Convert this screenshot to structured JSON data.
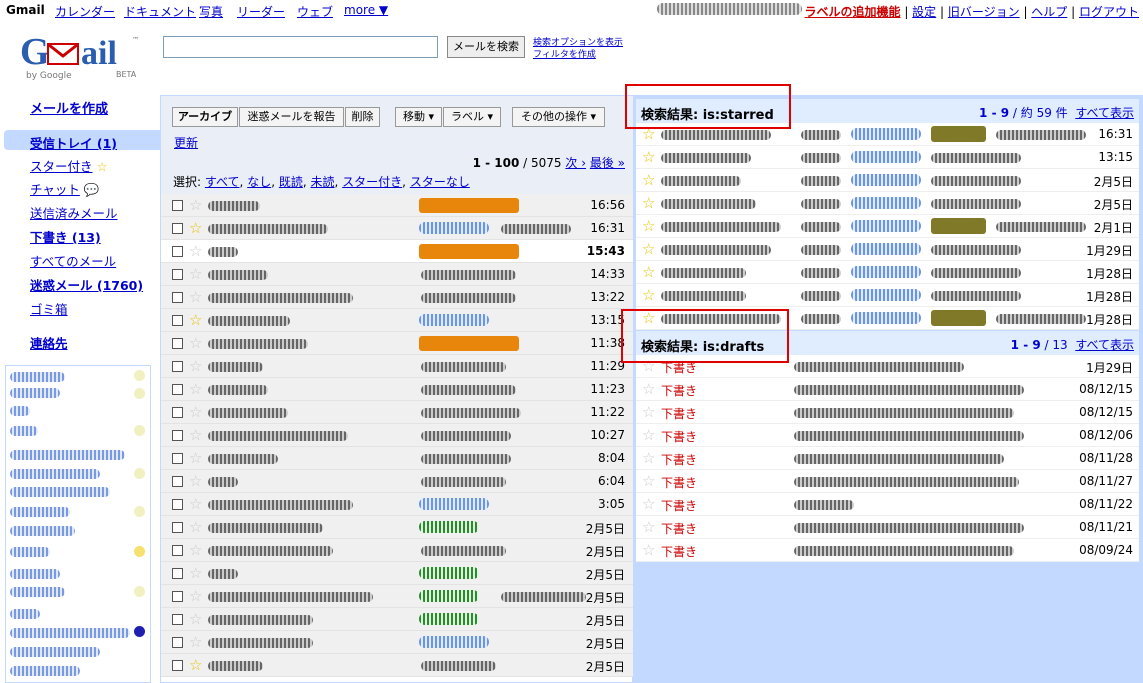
{
  "topnav": {
    "brand": "Gmail",
    "links": [
      "カレンダー",
      "ドキュメント",
      "写真",
      "リーダー",
      "ウェブ",
      "more ▼"
    ],
    "right_links": [
      "ラベルの追加機能",
      "設定",
      "旧バージョン",
      "ヘルプ",
      "ログアウト"
    ]
  },
  "logo": {
    "text_g": "G",
    "text_m": "M",
    "text_ail": "ail",
    "by": "by Google",
    "beta": "BETA",
    "tm": "™"
  },
  "search": {
    "button": "メールを検索",
    "options": "検索オプションを表示",
    "filter": "フィルタを作成"
  },
  "sidebar": {
    "compose": "メールを作成",
    "items": [
      {
        "label": "受信トレイ (1)",
        "bold": true
      },
      {
        "label": "スター付き",
        "icon": "star-icon"
      },
      {
        "label": "チャット",
        "icon": "chat-bubble-icon"
      },
      {
        "label": "送信済みメール"
      },
      {
        "label": "下書き (13)",
        "bold": true
      },
      {
        "label": "すべてのメール"
      },
      {
        "label": "迷惑メール (1760)",
        "bold": true
      },
      {
        "label": "ゴミ箱"
      }
    ],
    "contacts": "連絡先"
  },
  "toolbar": {
    "archive": "アーカイブ",
    "spam": "迷惑メールを報告",
    "delete": "削除",
    "move": "移動 ▾",
    "label": "ラベル ▾",
    "more": "その他の操作 ▾",
    "refresh": "更新",
    "pager_range": "1 - 100",
    "pager_total": " / 5075 ",
    "next": "次 ›",
    "last": "最後 »",
    "select_prefix": "選択: ",
    "select_options": [
      "すべて",
      "なし",
      "既読",
      "未読",
      "スター付き",
      "スターなし"
    ]
  },
  "inbox": {
    "rows": [
      {
        "time": "16:56",
        "starred": false,
        "unread": false,
        "tag": "orange"
      },
      {
        "time": "16:31",
        "starred": true,
        "unread": false,
        "tag": "blue"
      },
      {
        "time": "15:43",
        "starred": false,
        "unread": true,
        "tag": "orange"
      },
      {
        "time": "14:33",
        "starred": false,
        "unread": false,
        "tag": "none"
      },
      {
        "time": "13:22",
        "starred": false,
        "unread": false,
        "tag": "none"
      },
      {
        "time": "13:15",
        "starred": true,
        "unread": false,
        "tag": "blue"
      },
      {
        "time": "11:38",
        "starred": false,
        "unread": false,
        "tag": "orange"
      },
      {
        "time": "11:29",
        "starred": false,
        "unread": false,
        "tag": "none"
      },
      {
        "time": "11:23",
        "starred": false,
        "unread": false,
        "tag": "none"
      },
      {
        "time": "11:22",
        "starred": false,
        "unread": false,
        "tag": "none"
      },
      {
        "time": "10:27",
        "starred": false,
        "unread": false,
        "tag": "none"
      },
      {
        "time": "8:04",
        "starred": false,
        "unread": false,
        "tag": "none"
      },
      {
        "time": "6:04",
        "starred": false,
        "unread": false,
        "tag": "none"
      },
      {
        "time": "3:05",
        "starred": false,
        "unread": false,
        "tag": "blue"
      },
      {
        "time": "2月5日",
        "starred": false,
        "unread": false,
        "tag": "green"
      },
      {
        "time": "2月5日",
        "starred": false,
        "unread": false,
        "tag": "none"
      },
      {
        "time": "2月5日",
        "starred": false,
        "unread": false,
        "tag": "green"
      },
      {
        "time": "2月5日",
        "starred": false,
        "unread": false,
        "tag": "green"
      },
      {
        "time": "2月5日",
        "starred": false,
        "unread": false,
        "tag": "green"
      },
      {
        "time": "2月5日",
        "starred": false,
        "unread": false,
        "tag": "blue"
      },
      {
        "time": "2月5日",
        "starred": true,
        "unread": false,
        "tag": "none"
      }
    ]
  },
  "starred_panel": {
    "title": "検索結果: is:starred",
    "count_range": "1 - 9",
    "count_total": " / 約 59 件",
    "show_all": "すべて表示",
    "rows": [
      {
        "time": "16:31"
      },
      {
        "time": "13:15"
      },
      {
        "time": "2月5日"
      },
      {
        "time": "2月5日"
      },
      {
        "time": "2月1日"
      },
      {
        "time": "1月29日"
      },
      {
        "time": "1月28日"
      },
      {
        "time": "1月28日"
      },
      {
        "time": "1月28日"
      }
    ]
  },
  "drafts_panel": {
    "title": "検索結果: is:drafts",
    "count_range": "1 - 9",
    "count_total": " / 13",
    "show_all": "すべて表示",
    "draft_label": "下書き",
    "rows": [
      {
        "time": "1月29日"
      },
      {
        "time": "08/12/15"
      },
      {
        "time": "08/12/15"
      },
      {
        "time": "08/12/06"
      },
      {
        "time": "08/11/28"
      },
      {
        "time": "08/11/27"
      },
      {
        "time": "08/11/22"
      },
      {
        "time": "08/11/21"
      },
      {
        "time": "08/09/24"
      }
    ]
  },
  "colors": {
    "accent": "#c3d9ff",
    "label_orange": "#e8860c",
    "highlight_box": "#e00000",
    "star": "#e8c000",
    "draft": "#cc0000"
  }
}
